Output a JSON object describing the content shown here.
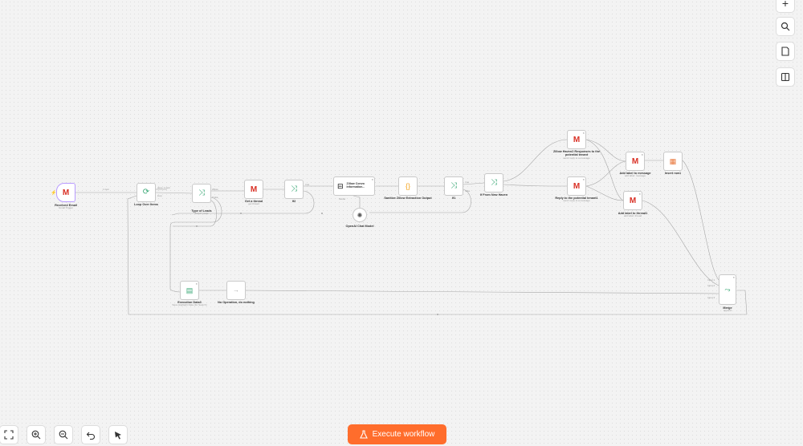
{
  "nodes": {
    "received_email": {
      "label": "Received Email",
      "sub": "Gmail Trigger"
    },
    "loop": {
      "label": "Loop Over Items",
      "port_done": "done",
      "port_loop": "loop"
    },
    "type_of_leads": {
      "label": "Type of Leads",
      "sub": "Switch mode",
      "port1": "Zillow",
      "port2": "Trulia"
    },
    "get_thread": {
      "label": "Get a thread",
      "sub": "get thread"
    },
    "if2": {
      "label": "If2",
      "port_true": "true"
    },
    "zillow_info": {
      "label": "Zillow Convo Information...",
      "port_model": "Model"
    },
    "openai": {
      "label": "OpenAI Chat Model"
    },
    "sanitize": {
      "label": "Sanitize Zillow Extraction Output"
    },
    "if1": {
      "label": "If1",
      "port_true": "true",
      "port_false": "false"
    },
    "if_from_new_haven": {
      "label": "If From New Haven"
    },
    "zillow_haven": {
      "label": "Zillow Haven2 Responses to the potential tenant",
      "sub": "send: reply to a message"
    },
    "reply_tenant": {
      "label": "Reply to the potential tenant1",
      "sub": "send: reply to a message"
    },
    "add_label_message": {
      "label": "Add label to message",
      "sub": "add label: message"
    },
    "add_label_thread": {
      "label": "Add label to thread1",
      "sub": "add label: thread"
    },
    "insert_row": {
      "label": "Insert row1"
    },
    "exec_data": {
      "label": "Execution Data3",
      "sub": "Save Highlight Data (for Search)"
    },
    "noop": {
      "label": "No Operation, do nothing"
    },
    "merge": {
      "label": "Merge",
      "sub": "append",
      "in1": "Input 1",
      "in2": "Input 2",
      "in3": "Input 3"
    }
  },
  "edge_labels": {
    "received_to_loop": "1 item",
    "loop_count": "1 item"
  },
  "toolbar_right": {
    "zoom_in": "+",
    "search": "search-icon",
    "sticky": "sticky-note-icon",
    "panel": "panel-icon"
  },
  "toolbar_bottom": {
    "fit": "fit-view-icon",
    "zoom_in": "zoom-in-icon",
    "zoom_out": "zoom-out-icon",
    "undo": "undo-icon",
    "tidy": "tidy-up-icon"
  },
  "execute_button": {
    "label": "Execute workflow"
  },
  "colors": {
    "accent": "#ff6d2c",
    "gmail": "#d93025",
    "switch": "#3aa876",
    "sheets": "#e8763a"
  }
}
